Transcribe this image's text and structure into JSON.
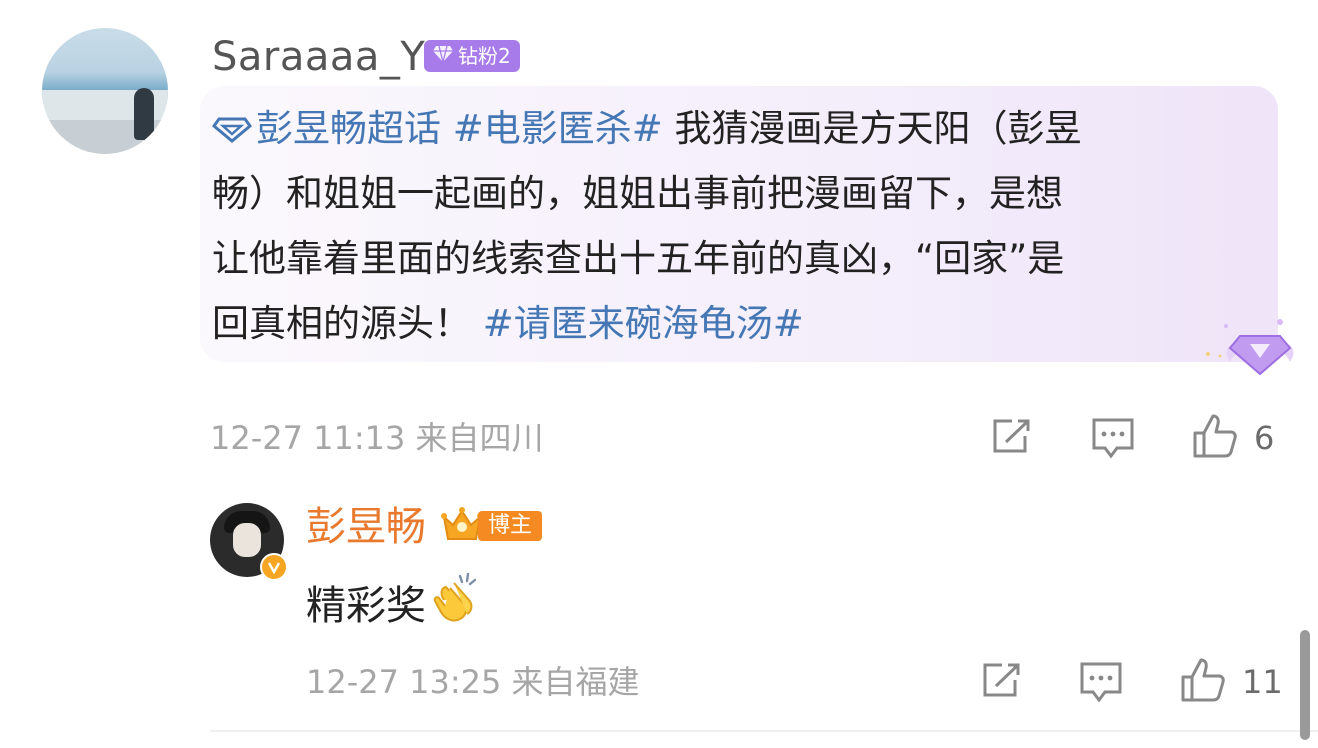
{
  "comment": {
    "username": "Saraaaa_Y",
    "fan_badge": {
      "label": "钻粉2",
      "icon": "diamond-icon"
    },
    "body": {
      "line1_topics": "彭昱畅超话 #电影匿杀#",
      "line1_rest": " 我猜漫画是方天阳（彭昱",
      "line2": "畅）和姐姐一起画的，姐姐出事前把漫画留下，是想",
      "line3": "让他靠着里面的线索查出十五年前的真凶，“回家”是",
      "line4_text": "回真相的源头！",
      "line4_topic": "#请匿来碗海龟汤#"
    },
    "meta": "12-27 11:13  来自四川",
    "actions": {
      "share_icon": "share-icon",
      "comment_icon": "comment-icon",
      "like_icon": "thumbs-up-icon",
      "likes": "6"
    },
    "colors": {
      "topic": "#4577b5",
      "badge": "#a77bea"
    }
  },
  "reply": {
    "username": "彭昱畅",
    "badge": {
      "label": "博主",
      "icon": "crown-icon"
    },
    "text": "精彩奖",
    "emoji": "clapping-hands-icon",
    "meta": "12-27 13:25  来自福建",
    "actions": {
      "likes": "11"
    },
    "colors": {
      "username": "#e8792d",
      "badge": "#f68a22"
    }
  }
}
